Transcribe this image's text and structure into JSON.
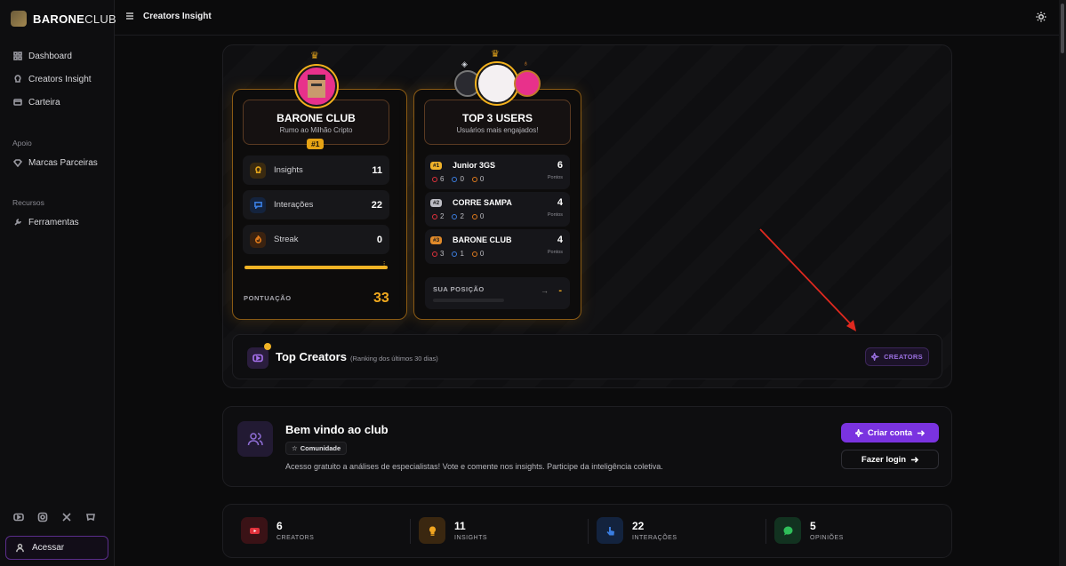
{
  "brand": {
    "bold": "BARONE",
    "light": "CLUB"
  },
  "nav": {
    "main": [
      {
        "label": "Dashboard",
        "icon": "grid-icon"
      },
      {
        "label": "Creators Insight",
        "icon": "lightbulb-icon"
      },
      {
        "label": "Carteira",
        "icon": "wallet-icon"
      }
    ],
    "apoio_title": "Apoio",
    "apoio": [
      {
        "label": "Marcas Parceiras",
        "icon": "gem-icon"
      }
    ],
    "recursos_title": "Recursos",
    "recursos": [
      {
        "label": "Ferramentas",
        "icon": "wrench-icon"
      }
    ],
    "access_label": "Acessar"
  },
  "header": {
    "title": "Creators Insight"
  },
  "club_card": {
    "title": "BARONE CLUB",
    "subtitle": "Rumo ao Milhão Cripto",
    "rank": "#1",
    "stats": [
      {
        "label": "Insights",
        "value": "11",
        "color": "#e0a21a",
        "bg": "#3a2a10"
      },
      {
        "label": "Interações",
        "value": "22",
        "color": "#3a7de0",
        "bg": "#14233d"
      },
      {
        "label": "Streak",
        "value": "0",
        "color": "#e07a1a",
        "bg": "#3a2210"
      }
    ],
    "progress": 1.0,
    "score_label": "PONTUAÇÃO",
    "score": "33"
  },
  "top_card": {
    "title": "TOP 3 USERS",
    "subtitle": "Usuários mais engajados!",
    "users": [
      {
        "rank": "#1",
        "rank_color": "#f0b22a",
        "name": "Junior 3GS",
        "likes": "6",
        "comments": "0",
        "streak": "0",
        "points": "6",
        "points_label": "Pontos"
      },
      {
        "rank": "#2",
        "rank_color": "#bdbdc4",
        "name": "CORRE SAMPA",
        "likes": "2",
        "comments": "2",
        "streak": "0",
        "points": "4",
        "points_label": "Pontos"
      },
      {
        "rank": "#3",
        "rank_color": "#e08a2a",
        "name": "BARONE CLUB",
        "likes": "3",
        "comments": "1",
        "streak": "0",
        "points": "4",
        "points_label": "Pontos"
      }
    ],
    "position_label": "SUA POSIÇÃO",
    "position_value": "-"
  },
  "top_creators": {
    "title": "Top Creators",
    "subtitle": "(Ranking dos últimos 30 dias)",
    "button": "CREATORS"
  },
  "welcome": {
    "title": "Bem vindo ao club",
    "tag": "Comunidade",
    "description": "Acesso gratuito a análises de especialistas! Vote e comente nos insights. Participe da inteligência coletiva.",
    "primary_button": "Criar conta",
    "secondary_button": "Fazer login"
  },
  "summary": [
    {
      "value": "6",
      "label": "CREATORS",
      "color": "#e0313b",
      "bg": "#3a1216"
    },
    {
      "value": "11",
      "label": "INSIGHTS",
      "color": "#f0a520",
      "bg": "#3a2710"
    },
    {
      "value": "22",
      "label": "INTERAÇÕES",
      "color": "#3a7de0",
      "bg": "#13233e"
    },
    {
      "value": "5",
      "label": "OPINIÕES",
      "color": "#2fbf5a",
      "bg": "#123220"
    }
  ]
}
